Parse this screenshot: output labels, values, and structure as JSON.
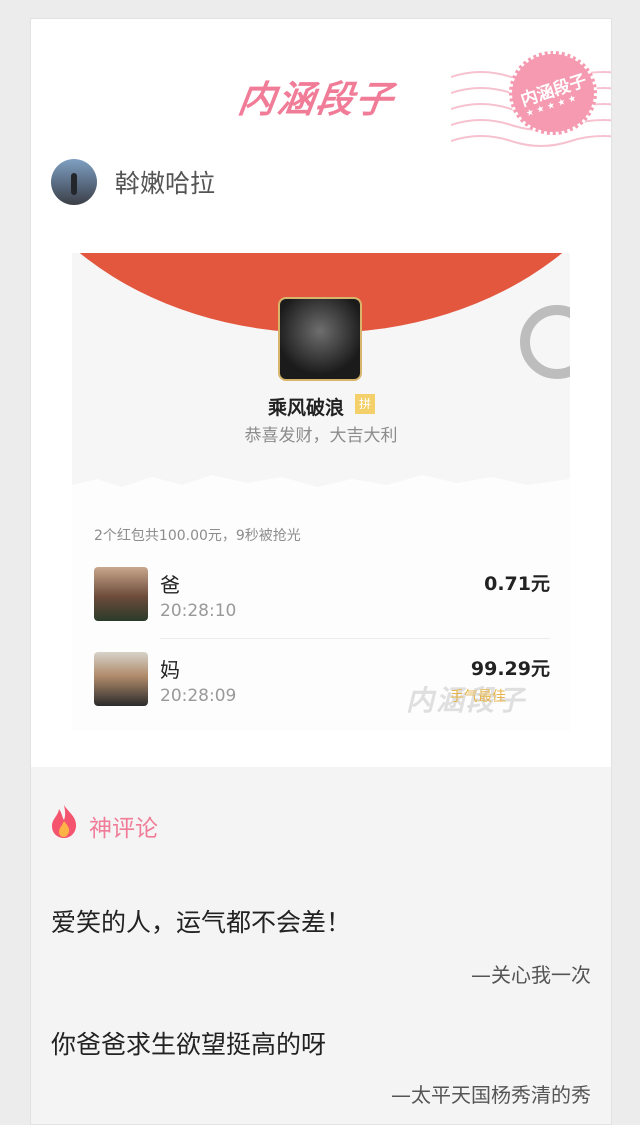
{
  "header": {
    "logo_text": "内涵段子",
    "stamp_text": "内涵段子",
    "stamp_stars": "★★★★★"
  },
  "author": {
    "name": "斡嫩哈拉"
  },
  "screenshot": {
    "sender_name": "乘风破浪",
    "sender_badge": "拼",
    "blessing": "恭喜发财，大吉大利",
    "summary": "2个红包共100.00元，9秒被抢光",
    "receivers": [
      {
        "name": "爸",
        "time": "20:28:10",
        "amount": "0.71元"
      },
      {
        "name": "妈",
        "time": "20:28:09",
        "amount": "99.29元",
        "tag": "手气最佳"
      }
    ],
    "watermark": "内涵段子"
  },
  "comments": {
    "section_title": "神评论",
    "items": [
      {
        "text": "爱笑的人，运气都不会差！",
        "author": "—关心我一次"
      },
      {
        "text": "你爸爸求生欲望挺高的呀",
        "author": "—太平天国杨秀清的秀"
      }
    ]
  },
  "colors": {
    "accent_pink": "#f07c98",
    "red_packet": "#e4573f"
  }
}
